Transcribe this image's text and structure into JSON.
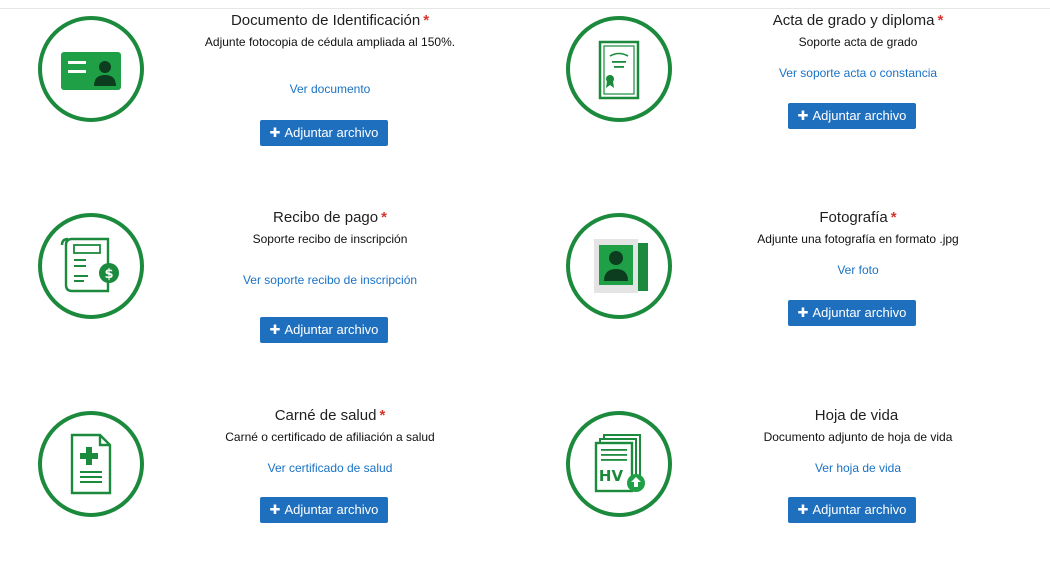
{
  "documents": [
    {
      "title": "Documento de Identificación",
      "required_mark": "*",
      "description": "Adjunte fotocopia de cédula ampliada al 150%.",
      "link_text": "Ver documento",
      "button_label": "Adjuntar archivo",
      "icon": "id-card-icon"
    },
    {
      "title": "Acta de grado y diploma",
      "required_mark": "*",
      "description": "Soporte acta de grado",
      "link_text": "Ver soporte acta o constancia",
      "button_label": "Adjuntar archivo",
      "icon": "diploma-icon"
    },
    {
      "title": "Recibo de pago",
      "required_mark": "*",
      "description": "Soporte recibo de inscripción",
      "link_text": "Ver soporte recibo de inscripción",
      "button_label": "Adjuntar archivo",
      "icon": "receipt-icon"
    },
    {
      "title": "Fotografía",
      "required_mark": "*",
      "description": "Adjunte una fotografía en formato .jpg",
      "link_text": "Ver foto",
      "button_label": "Adjuntar archivo",
      "icon": "photo-icon"
    },
    {
      "title": "Carné de salud",
      "required_mark": "*",
      "description": "Carné o certificado de afiliación a salud",
      "link_text": "Ver certificado de salud",
      "button_label": "Adjuntar archivo",
      "icon": "health-card-icon"
    },
    {
      "title": "Hoja de vida",
      "required_mark": "",
      "description": "Documento adjunto de hoja de vida",
      "link_text": "Ver hoja de vida",
      "button_label": "Adjuntar archivo",
      "icon": "resume-hv-icon",
      "icon_text": "HV"
    }
  ],
  "colors": {
    "brand_green": "#1b8a3c",
    "button_blue": "#1f6fbf",
    "link_blue": "#1a72c4",
    "required_red": "#d9342b"
  }
}
